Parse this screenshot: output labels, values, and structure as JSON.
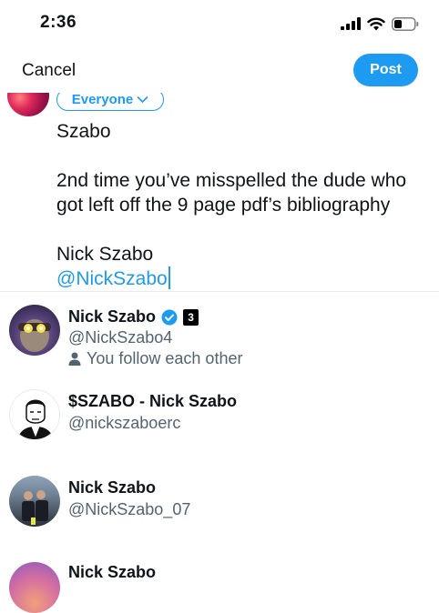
{
  "status_bar": {
    "time": "2:36"
  },
  "nav": {
    "cancel_label": "Cancel",
    "post_label": "Post"
  },
  "audience": {
    "label": "Everyone"
  },
  "compose": {
    "line1": "Szabo",
    "line2": "2nd time you’ve misspelled the dude who got left off the 9 page pdf’s bibliography",
    "line3": "Nick Szabo",
    "mention": "@NickSzabo"
  },
  "suggestions": [
    {
      "name": "Nick Szabo",
      "handle": "@NickSzabo4",
      "verified": true,
      "badge": "3",
      "meta": "You follow each other",
      "avatar_colors": [
        "#ffe14d",
        "#7b5fa0"
      ]
    },
    {
      "name": "$SZABO - Nick Szabo",
      "handle": "@nickszaboerc",
      "verified": false
    },
    {
      "name": "Nick Szabo",
      "handle": "@NickSzabo_07",
      "verified": false
    },
    {
      "name": "Nick Szabo",
      "verified": false
    }
  ],
  "colors": {
    "accent": "#1d9bf0",
    "text": "#0f1419",
    "secondary": "#536471"
  }
}
